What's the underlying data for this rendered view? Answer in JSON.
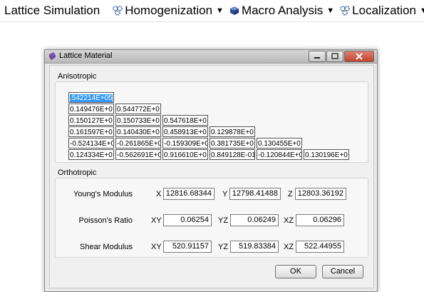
{
  "menubar": {
    "title": "Lattice Simulation",
    "items": [
      {
        "label": "Homogenization",
        "icon": "gear-cluster-icon"
      },
      {
        "label": "Macro Analysis",
        "icon": "cube-icon"
      },
      {
        "label": "Localization",
        "icon": "gear-cluster-icon"
      }
    ],
    "caret": "▼"
  },
  "dialog": {
    "title": "Lattice Material",
    "anisotropic": {
      "label": "Anisotropic",
      "rows": [
        [
          ".542214E+05"
        ],
        [
          "0.149476E+0",
          "0.544772E+0"
        ],
        [
          "0.150127E+0",
          "0.150733E+0",
          "0.547618E+0"
        ],
        [
          "0.161597E+0",
          "0.140430E+0",
          "0.458913E+0",
          "0.129878E+0"
        ],
        [
          "-0.524134E+0",
          "-0.261865E+0",
          "-0.159309E+0",
          "0.381735E+0",
          "0.130455E+0"
        ],
        [
          "0.124334E+0",
          "-0.562691E+0",
          "0.916610E+0",
          "0.849128E-01",
          "-0.120844E+0",
          "0.130196E+0"
        ]
      ]
    },
    "orthotropic": {
      "label": "Orthotropic",
      "youngs": {
        "label": "Young's Modulus",
        "axes": [
          "X",
          "Y",
          "Z"
        ],
        "values": [
          "12816.68344",
          "12798.41488",
          "12803.36192"
        ]
      },
      "poisson": {
        "label": "Poisson's Ratio",
        "axes": [
          "XY",
          "YZ",
          "XZ"
        ],
        "values": [
          "0.06254",
          "0.06249",
          "0.06296"
        ]
      },
      "shear": {
        "label": "Shear Modulus",
        "axes": [
          "XY",
          "YZ",
          "XZ"
        ],
        "values": [
          "520.91157",
          "519.83384",
          "522.44955"
        ]
      }
    },
    "buttons": {
      "ok": "OK",
      "cancel": "Cancel"
    }
  },
  "colors": {
    "selection": "#3399ff",
    "close_button": "#c2412f"
  }
}
